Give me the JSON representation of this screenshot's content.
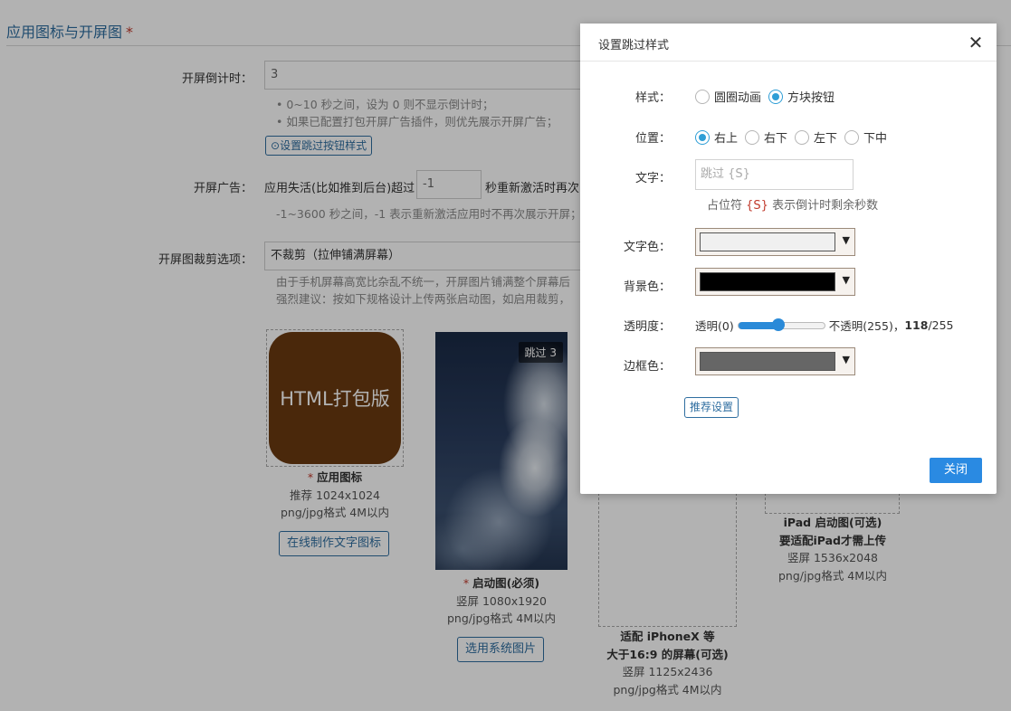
{
  "page": {
    "section_title": "应用图标与开屏图",
    "required_mark": "*",
    "countdown": {
      "label": "开屏倒计时：",
      "value": "3",
      "hints": [
        "• 0~10 秒之间，设为 0 则不显示倒计时；",
        "• 如果已配置打包开屏广告插件，则优先展示开屏广告；"
      ],
      "skip_button_label": "设置跳过按钮样式"
    },
    "splash_ad": {
      "label": "开屏广告：",
      "text_before": "应用失活(比如推到后台)超过",
      "value": "-1",
      "text_after": "秒重新激活时再次",
      "hint": "-1~3600 秒之间，-1 表示重新激活应用时不再次展示开屏；"
    },
    "crop": {
      "label": "开屏图裁剪选项：",
      "value": "不裁剪（拉伸铺满屏幕）",
      "hint_line1": "由于手机屏幕高宽比杂乱不统一，开屏图片铺满整个屏幕后",
      "hint_line2": "强烈建议：按如下规格设计上传两张启动图，如启用裁剪，"
    },
    "app_icon": {
      "icon_text": "HTML打包版",
      "required": "*",
      "title": "应用图标",
      "size": "推荐 1024x1024",
      "format": "png/jpg格式 4M以内",
      "button": "在线制作文字图标"
    },
    "splash": {
      "skip_badge": "跳过 3",
      "required": "*",
      "title": "启动图(必须)",
      "size": "竖屏 1080x1920",
      "format": "png/jpg格式 4M以内",
      "button": "选用系统图片"
    },
    "iphonex": {
      "title_line1": "适配 iPhoneX 等",
      "title_line2": "大于16:9 的屏幕(可选)",
      "size": "竖屏 1125x2436",
      "format": "png/jpg格式 4M以内"
    },
    "ipad": {
      "title_line1": "iPad 启动图(可选)",
      "title_line2": "要适配iPad才需上传",
      "size": "竖屏 1536x2048",
      "format": "png/jpg格式 4M以内"
    }
  },
  "modal": {
    "title": "设置跳过样式",
    "close_icon": "close-icon",
    "style": {
      "label": "样式：",
      "options": [
        "圆圈动画",
        "方块按钮"
      ],
      "selected": 1
    },
    "position": {
      "label": "位置：",
      "options": [
        "右上",
        "右下",
        "左下",
        "下中"
      ],
      "selected": 0
    },
    "text": {
      "label": "文字：",
      "value": "跳过 {S}",
      "hint_prefix": "占位符 ",
      "hint_placeholder": "{S}",
      "hint_suffix": " 表示倒计时剩余秒数"
    },
    "text_color": {
      "label": "文字色：",
      "color": "#f0f0f0"
    },
    "bg_color": {
      "label": "背景色：",
      "color": "#000000"
    },
    "opacity": {
      "label": "透明度：",
      "min_label": "透明(0)",
      "max_label": "不透明(255)，",
      "value": "118",
      "max_value": "/255",
      "fraction": 0.4627
    },
    "border_color": {
      "label": "边框色：",
      "color": "#666666"
    },
    "recommend_button": "推荐设置",
    "close_button": "关闭"
  },
  "colors": {
    "accent": "#2a8ae2",
    "link": "#2f6ea0",
    "required": "#c0392b",
    "overlay": "rgba(0,0,0,0.3)",
    "app_icon_bg": "#6b3a10"
  }
}
